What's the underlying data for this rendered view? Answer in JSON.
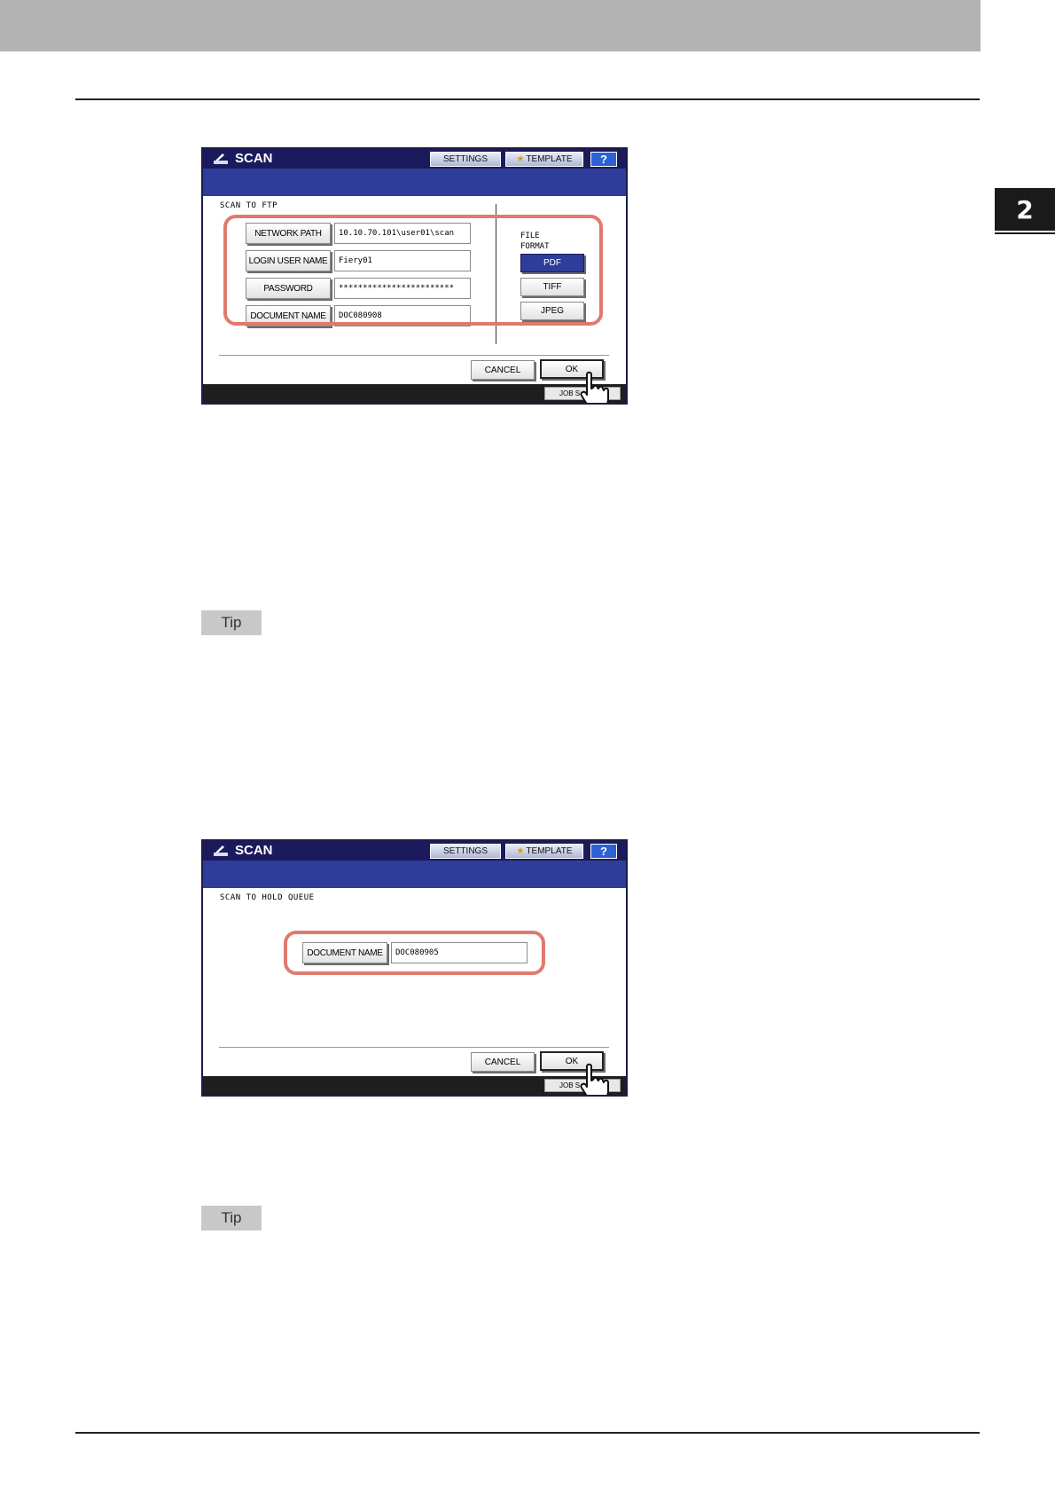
{
  "page": {
    "chapter_number": "2",
    "tip_label_1": "Tip",
    "tip_label_2": "Tip"
  },
  "panel1": {
    "title": "SCAN",
    "settings_label": "SETTINGS",
    "template_label": "TEMPLATE",
    "help_label": "?",
    "subtitle": "SCAN TO FTP",
    "fields": [
      {
        "label": "NETWORK PATH",
        "value": "10.10.70.101\\user01\\scan"
      },
      {
        "label": "LOGIN USER NAME",
        "value": "Fiery01"
      },
      {
        "label": "PASSWORD",
        "value": "************************"
      },
      {
        "label": "DOCUMENT NAME",
        "value": "DOC080908"
      }
    ],
    "file_format_line1": "FILE",
    "file_format_line2": "FORMAT",
    "formats": [
      {
        "label": "PDF",
        "selected": true
      },
      {
        "label": "TIFF",
        "selected": false
      },
      {
        "label": "JPEG",
        "selected": false
      }
    ],
    "cancel_label": "CANCEL",
    "ok_label": "OK",
    "job_label": "JOB S"
  },
  "panel2": {
    "title": "SCAN",
    "settings_label": "SETTINGS",
    "template_label": "TEMPLATE",
    "help_label": "?",
    "subtitle": "SCAN TO HOLD QUEUE",
    "field": {
      "label": "DOCUMENT NAME",
      "value": "DOC080905"
    },
    "cancel_label": "CANCEL",
    "ok_label": "OK",
    "job_label": "JOB S"
  },
  "colors": {
    "titlebar": "#1a1a5c",
    "blueband": "#2e3d9a",
    "highlight": "#e07a6e",
    "help_button": "#2c62d6"
  }
}
